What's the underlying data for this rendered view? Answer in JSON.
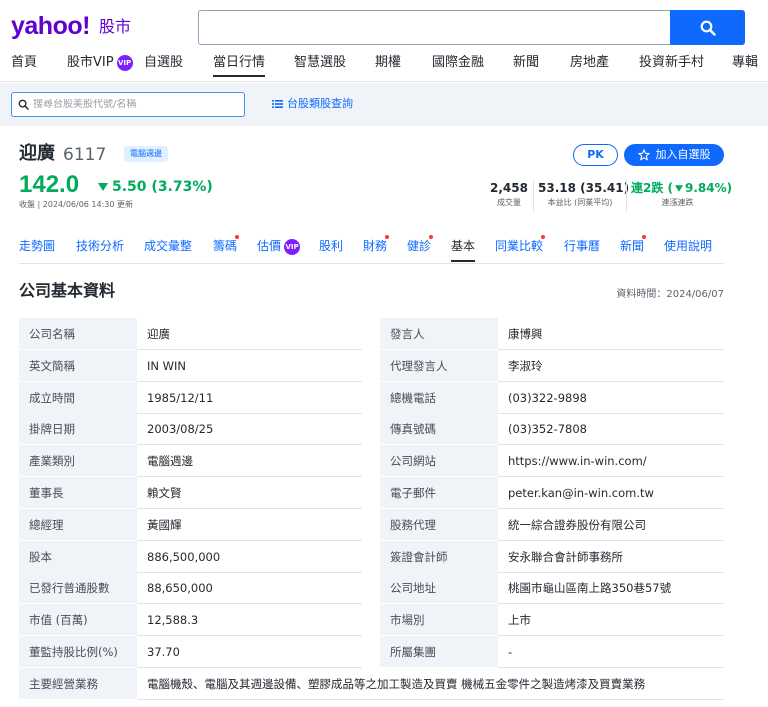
{
  "header": {
    "logo": "yahoo!",
    "logo_sub": "股市"
  },
  "main_nav": [
    {
      "label": "首頁"
    },
    {
      "label": "股市VIP",
      "badge": "VIP"
    },
    {
      "label": "自選股"
    },
    {
      "label": "當日行情",
      "active": true
    },
    {
      "label": "智慧選股"
    },
    {
      "label": "期權"
    },
    {
      "label": "國際金融"
    },
    {
      "label": "新聞"
    },
    {
      "label": "房地產"
    },
    {
      "label": "投資新手村"
    },
    {
      "label": "專輯"
    }
  ],
  "sub_bar": {
    "search_placeholder": "搜尋台股美股代號/名稱",
    "category_link": "台股類股查詢"
  },
  "stock": {
    "name": "迎廣",
    "code": "6117",
    "sector": "電腦週邊",
    "price": "142.0",
    "change": "5.50 (3.73%)",
    "close_time": "收盤 | 2024/06/06 14:30 更新",
    "pk_label": "PK",
    "watch_label": "加入自選股",
    "stats": [
      {
        "value": "2,458",
        "label": "成交量"
      },
      {
        "value": "53.18 (35.41)",
        "label": "本益比 (同業平均)"
      },
      {
        "value": "連2跌 (",
        "value_change": "9.84%",
        "value_end": ")",
        "label": "連漲連跌"
      }
    ]
  },
  "stock_tabs": [
    {
      "label": "走勢圖"
    },
    {
      "label": "技術分析"
    },
    {
      "label": "成交彙整"
    },
    {
      "label": "籌碼",
      "dot": true
    },
    {
      "label": "估價",
      "badge": "VIP"
    },
    {
      "label": "股利"
    },
    {
      "label": "財務",
      "dot": true
    },
    {
      "label": "健診",
      "dot": true
    },
    {
      "label": "基本",
      "active": true
    },
    {
      "label": "同業比較",
      "dot": true
    },
    {
      "label": "行事曆"
    },
    {
      "label": "新聞",
      "dot": true
    },
    {
      "label": "使用說明"
    }
  ],
  "section": {
    "title": "公司基本資料",
    "data_time": "資料時間：2024/06/07"
  },
  "rows": [
    {
      "l1": "公司名稱",
      "v1": "迎廣",
      "l2": "發言人",
      "v2": "康博興"
    },
    {
      "l1": "英文簡稱",
      "v1": "IN WIN",
      "l2": "代理發言人",
      "v2": "李淑玲"
    },
    {
      "l1": "成立時間",
      "v1": "1985/12/11",
      "l2": "總機電話",
      "v2": "(03)322-9898"
    },
    {
      "l1": "掛牌日期",
      "v1": "2003/08/25",
      "l2": "傳真號碼",
      "v2": "(03)352-7808"
    },
    {
      "l1": "產業類別",
      "v1": "電腦週邊",
      "l2": "公司網站",
      "v2": "https://www.in-win.com/"
    },
    {
      "l1": "董事長",
      "v1": "賴文賢",
      "l2": "電子郵件",
      "v2": "peter.kan@in-win.com.tw"
    },
    {
      "l1": "總經理",
      "v1": "黃國輝",
      "l2": "股務代理",
      "v2": "統一綜合證券股份有限公司"
    },
    {
      "l1": "股本",
      "v1": "886,500,000",
      "l2": "簽證會計師",
      "v2": "安永聯合會計師事務所"
    },
    {
      "l1": "已發行普通股數",
      "v1": "88,650,000",
      "l2": "公司地址",
      "v2": "桃園市龜山區南上路350巷57號"
    },
    {
      "l1": "市值 (百萬)",
      "v1": "12,588.3",
      "l2": "市場別",
      "v2": "上市"
    },
    {
      "l1": "董監持股比例(%)",
      "v1": "37.70",
      "l2": "所屬集團",
      "v2": "-"
    }
  ],
  "business": {
    "label": "主要經營業務",
    "value": "電腦機殼、電腦及其週邊設備、塑膠成品等之加工製造及買賣 機械五金零件之製造烤漆及買賣業務"
  },
  "colors": {
    "brand": "#6001d2",
    "accent": "#0f69ff",
    "down": "#00ab5e",
    "label_bg": "#f0f4f8"
  }
}
